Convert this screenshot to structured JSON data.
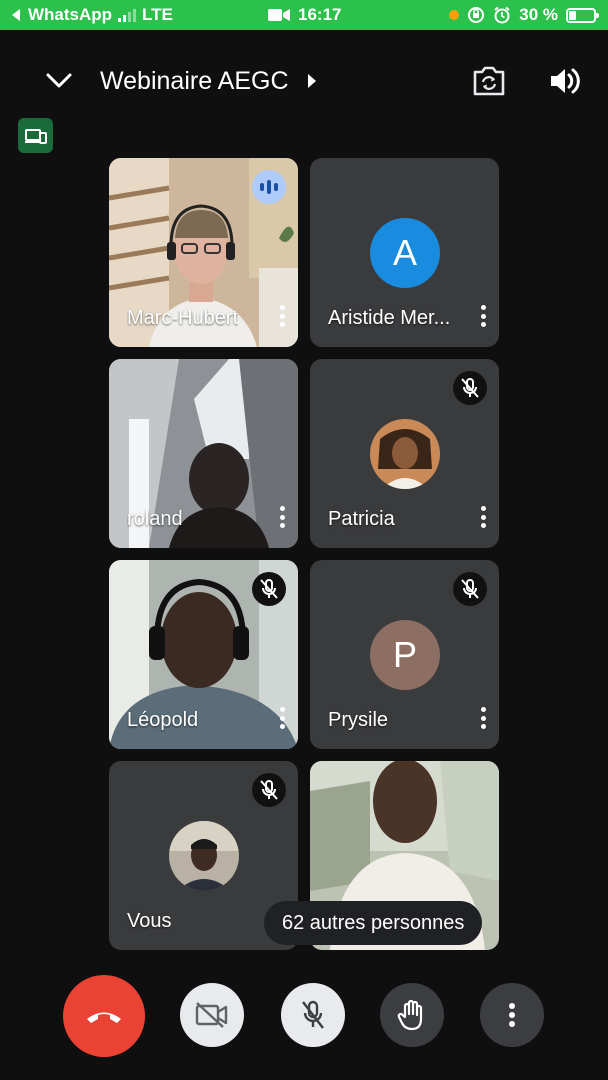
{
  "status_bar": {
    "back_app": "WhatsApp",
    "network": "LTE",
    "time": "16:17",
    "battery_percent": "30 %",
    "battery_level": 0.3
  },
  "header": {
    "title": "Webinaire AEGC"
  },
  "tiles": [
    {
      "name": "Marc-Hubert",
      "type": "video",
      "speaking": true
    },
    {
      "name": "Aristide Mer...",
      "type": "letter",
      "letter": "A",
      "avatar_color": "#1a8ce0"
    },
    {
      "name": "roland",
      "type": "video"
    },
    {
      "name": "Patricia",
      "type": "photo",
      "muted": true
    },
    {
      "name": "Léopold",
      "type": "video",
      "muted": true
    },
    {
      "name": "Prysile",
      "type": "letter",
      "letter": "P",
      "avatar_color": "#8d6e63",
      "muted": true
    },
    {
      "name": "Vous",
      "type": "photo",
      "muted": true
    },
    {
      "name": "",
      "type": "video"
    }
  ],
  "others_count_label": "62 autres personnes",
  "colors": {
    "statusbar": "#2cc04c",
    "hangup": "#ea4335",
    "speaking_badge": "#aecbfa",
    "cast_button": "#1a6b3a"
  },
  "controls": [
    "hang-up",
    "camera-off",
    "mic-off",
    "raise-hand",
    "more-options"
  ]
}
